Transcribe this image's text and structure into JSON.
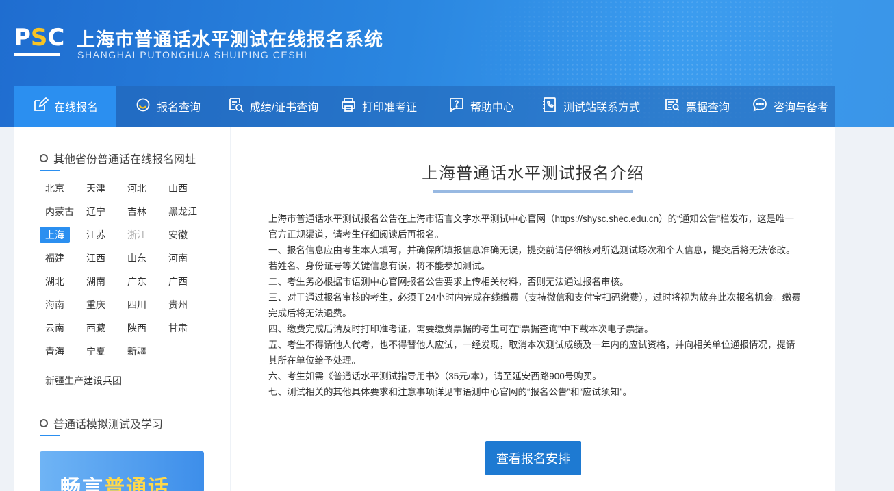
{
  "header": {
    "logo_letters": {
      "p": "P",
      "s": "S",
      "c": "C"
    },
    "title": "上海市普通话水平测试在线报名系统",
    "subtitle": "SHANGHAI PUTONGHUA SHUIPING CESHI"
  },
  "nav": [
    {
      "label": "在线报名",
      "icon": "edit-icon",
      "active": true
    },
    {
      "label": "报名查询",
      "icon": "refresh-search-icon"
    },
    {
      "label": "成绩/证书查询",
      "icon": "search-doc-icon"
    },
    {
      "label": "打印准考证",
      "icon": "printer-icon"
    },
    {
      "label": "帮助中心",
      "icon": "help-icon"
    },
    {
      "label": "测试站联系方式",
      "icon": "phone-book-icon"
    },
    {
      "label": "票据查询",
      "icon": "receipt-search-icon"
    },
    {
      "label": "咨询与备考",
      "icon": "chat-icon"
    }
  ],
  "sidebar": {
    "section1_title": "其他省份普通话在线报名网址",
    "provinces": [
      {
        "name": "北京"
      },
      {
        "name": "天津"
      },
      {
        "name": "河北"
      },
      {
        "name": "山西"
      },
      {
        "name": "内蒙古"
      },
      {
        "name": "辽宁"
      },
      {
        "name": "吉林"
      },
      {
        "name": "黑龙江"
      },
      {
        "name": "上海",
        "active": true
      },
      {
        "name": "江苏"
      },
      {
        "name": "浙江",
        "disabled": true
      },
      {
        "name": "安徽"
      },
      {
        "name": "福建"
      },
      {
        "name": "江西"
      },
      {
        "name": "山东"
      },
      {
        "name": "河南"
      },
      {
        "name": "湖北"
      },
      {
        "name": "湖南"
      },
      {
        "name": "广东"
      },
      {
        "name": "广西"
      },
      {
        "name": "海南"
      },
      {
        "name": "重庆"
      },
      {
        "name": "四川"
      },
      {
        "name": "贵州"
      },
      {
        "name": "云南"
      },
      {
        "name": "西藏"
      },
      {
        "name": "陕西"
      },
      {
        "name": "甘肃"
      },
      {
        "name": "青海"
      },
      {
        "name": "宁夏"
      },
      {
        "name": "新疆"
      }
    ],
    "extra_link": "新疆生产建设兵团",
    "section2_title": "普通话模拟测试及学习",
    "banner_text_a": "畅言",
    "banner_text_b": "普通话"
  },
  "main": {
    "title": "上海普通话水平测试报名介绍",
    "paragraphs": [
      "上海市普通话水平测试报名公告在上海市语言文字水平测试中心官网（https://shysc.shec.edu.cn）的“通知公告”栏发布，这是唯一官方正规渠道，请考生仔细阅读后再报名。",
      "一、报名信息应由考生本人填写，并确保所填报信息准确无误，提交前请仔细核对所选测试场次和个人信息，提交后将无法修改。若姓名、身份证号等关键信息有误，将不能参加测试。",
      "二、考生务必根据市语测中心官网报名公告要求上传相关材料，否则无法通过报名审核。",
      "三、对于通过报名审核的考生，必须于24小时内完成在线缴费（支持微信和支付宝扫码缴费），过时将视为放弃此次报名机会。缴费完成后将无法退费。",
      "四、缴费完成后请及时打印准考证，需要缴费票据的考生可在“票据查询”中下载本次电子票据。",
      "五、考生不得请他人代考，也不得替他人应试，一经发现，取消本次测试成绩及一年内的应试资格，并向相关单位通报情况，提请其所在单位给予处理。",
      "六、考生如需《普通话水平测试指导用书》（35元/本），请至延安西路900号购买。",
      "七、测试相关的其他具体要求和注意事项详见市语测中心官网的“报名公告”和“应试须知”。"
    ],
    "cta_label": "查看报名安排"
  },
  "colors": {
    "header_blue": "#2a86e0",
    "nav_active": "#2b8ff0",
    "cta": "#1e7ad2",
    "logo_accent": "#f7c325"
  }
}
